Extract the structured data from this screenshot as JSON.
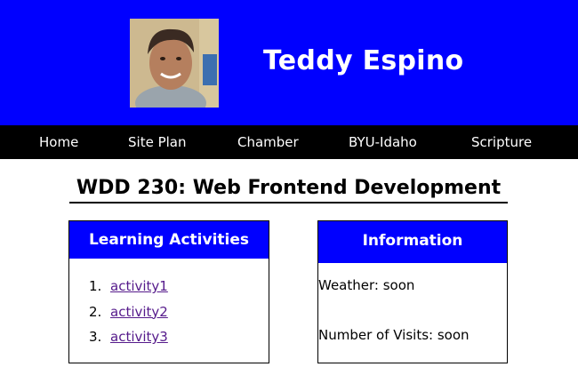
{
  "header": {
    "title": "Teddy Espino"
  },
  "nav": {
    "items": [
      {
        "label": "Home"
      },
      {
        "label": "Site Plan"
      },
      {
        "label": "Chamber"
      },
      {
        "label": "BYU-Idaho"
      },
      {
        "label": "Scripture"
      }
    ]
  },
  "main": {
    "title": "WDD 230: Web Frontend Development",
    "learning": {
      "heading": "Learning Activities",
      "items": [
        {
          "num": "1.",
          "label": "activity1"
        },
        {
          "num": "2.",
          "label": "activity2"
        },
        {
          "num": "3.",
          "label": "activity3"
        }
      ]
    },
    "info": {
      "heading": "Information",
      "weather": "Weather: soon",
      "visits": "Number of Visits: soon"
    }
  },
  "colors": {
    "brand": "#0000ff",
    "nav_bg": "#000000",
    "link": "#551a8b"
  }
}
